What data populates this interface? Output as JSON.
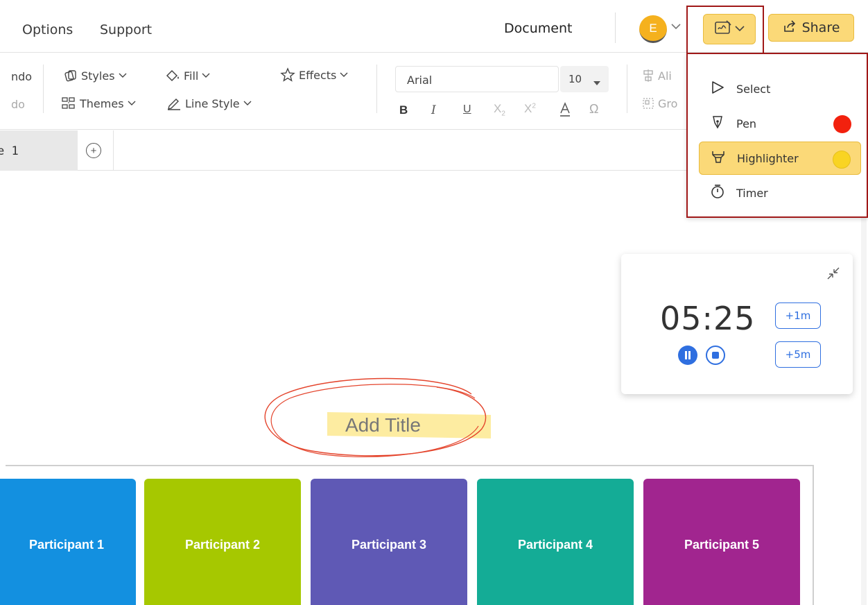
{
  "menu": {
    "options": "Options",
    "support": "Support"
  },
  "header": {
    "document": "Document",
    "avatar_initial": "E",
    "share": "Share"
  },
  "ribbon": {
    "undo": "ndo",
    "redo": "do",
    "styles": "Styles",
    "themes": "Themes",
    "fill": "Fill",
    "line_style": "Line Style",
    "effects": "Effects",
    "font_family": "Arial",
    "font_size": "10",
    "align": "Ali",
    "group": "Gro"
  },
  "tabs": {
    "page_tab": "e 1"
  },
  "dropdown": {
    "items": [
      {
        "label": "Select",
        "icon": "select-arrow-icon"
      },
      {
        "label": "Pen",
        "icon": "pen-icon",
        "color": "#f2210e"
      },
      {
        "label": "Highlighter",
        "icon": "highlighter-icon",
        "color": "#f9d423"
      },
      {
        "label": "Timer",
        "icon": "stopwatch-icon"
      }
    ]
  },
  "timer": {
    "time": "05:25",
    "add1": "+1m",
    "add5": "+5m"
  },
  "canvas": {
    "title": "Add Title"
  },
  "participants": [
    {
      "label": "Participant 1",
      "color": "#1390e0"
    },
    {
      "label": "Participant 2",
      "color": "#a6c800"
    },
    {
      "label": "Participant 3",
      "color": "#5f59b5"
    },
    {
      "label": "Participant 4",
      "color": "#14ac96"
    },
    {
      "label": "Participant 5",
      "color": "#a1258f"
    }
  ],
  "colors": {
    "accent_yellow": "#fbd978",
    "focus_red": "#a01818",
    "timer_blue": "#2f6fe0"
  }
}
